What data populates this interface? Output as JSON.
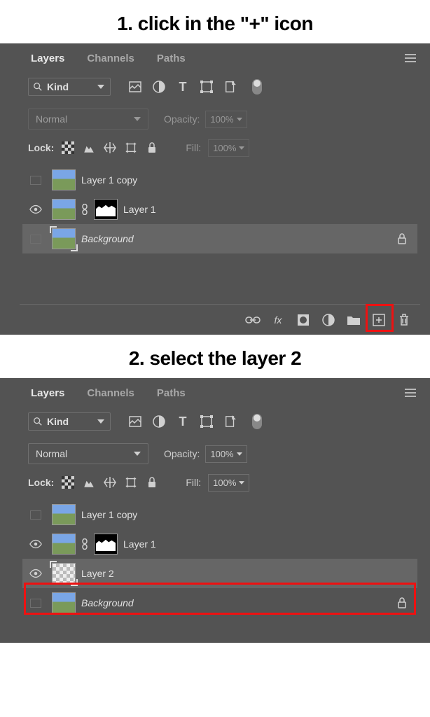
{
  "instructions": {
    "step1": "1. click in the \"+\" icon",
    "step2": "2. select the layer 2"
  },
  "panel1": {
    "tabs": [
      "Layers",
      "Channels",
      "Paths"
    ],
    "filter": {
      "label": "Kind"
    },
    "blend": {
      "mode": "Normal",
      "opacity_label": "Opacity:",
      "opacity_value": "100%"
    },
    "lock": {
      "label": "Lock:",
      "fill_label": "Fill:",
      "fill_value": "100%"
    },
    "layers": [
      {
        "name": "Layer 1 copy",
        "visible": false,
        "mask": false,
        "italic": false
      },
      {
        "name": "Layer 1",
        "visible": true,
        "mask": true,
        "italic": false
      },
      {
        "name": "Background",
        "visible": false,
        "mask": false,
        "italic": true,
        "locked": true
      }
    ]
  },
  "panel2": {
    "tabs": [
      "Layers",
      "Channels",
      "Paths"
    ],
    "filter": {
      "label": "Kind"
    },
    "blend": {
      "mode": "Normal",
      "opacity_label": "Opacity:",
      "opacity_value": "100%"
    },
    "lock": {
      "label": "Lock:",
      "fill_label": "Fill:",
      "fill_value": "100%"
    },
    "layers": [
      {
        "name": "Layer 1 copy",
        "visible": false,
        "mask": false,
        "italic": false
      },
      {
        "name": "Layer 1",
        "visible": true,
        "mask": true,
        "italic": false
      },
      {
        "name": "Layer 2",
        "visible": true,
        "mask": false,
        "italic": false,
        "checker": true,
        "selected": true
      },
      {
        "name": "Background",
        "visible": false,
        "mask": false,
        "italic": true,
        "locked": true
      }
    ]
  }
}
